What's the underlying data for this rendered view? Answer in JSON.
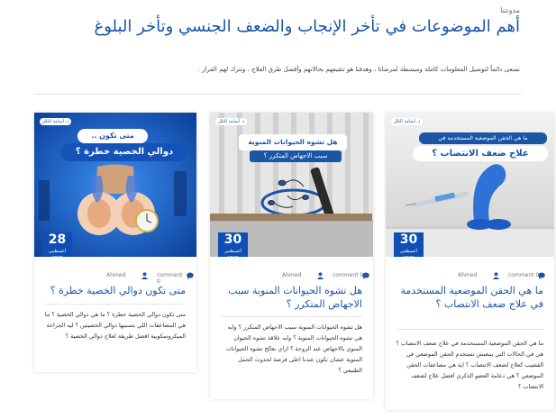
{
  "breadcrumb": "مدونتنا",
  "page_title": "أهم الموضوعات في تأخر الإنجاب والضعف الجنسي وتأخر البلوغ",
  "subtitle": "نسعى دائماً لتوصيل المعلومات كاملة ومبسطة لمرضانا ، وهدفنا هو تثقيفهم بحالاتهم وأفضل طرق العلاج ، وتترك لهم القرار .",
  "colors": {
    "title": "#1a56a6",
    "date_badge": "#0f4fb3"
  },
  "cards": [
    {
      "day": "30",
      "month": "أغسطس 2025",
      "author": "Ahmed",
      "comments": "comment 0",
      "image_logo": "د. أسامة الثلل",
      "image_heading_1": "ما هي الحقن الموضعية المستخدمة في",
      "image_heading_2": "علاج ضعف الانتصاب ؟",
      "title": "ما هي الحقن الموضعية المستخدمة في علاج ضعف الانتصاب ؟",
      "excerpt": "ما هي الحقن الموضعية المستخدمة في علاج ضعف الانتصاب ؟ هي في الحالات التي ينبغيش تستخدم الحقن الموضعي في القضيب كعلاج لضعف الانتصاب ؟ اية هي مضاعفات الحقن الموضعي ؟ هي دعامة العضو الذكري افضل علاج لضعف الانتصاب ؟"
    },
    {
      "day": "30",
      "month": "أغسطس 2025",
      "author": "Ahmed",
      "comments": "comment 0",
      "image_logo": "د. أسامة الثلل",
      "image_heading_1": "هل تشوه الحيوانات المنوية",
      "image_heading_2": "سبب الاجهاض المتكرر ؟",
      "title": "هل تشوه الحيوانات المنوية سبب الاجهاض المتكرر ؟",
      "excerpt": "هل تشوه الحيوانات المنوية سبب الاجهاض المتكرر ؟ وايه هي تشوه الحيوانات المنوية ؟ وايه علاقة تشوه الحيوان المنوي بالاجهاض عند الزوجة ؟ ازاي نعالج تشوه الحيوانات المنوية عشان نكون عندنا اعلى فرصة لحدوث الحمل الطبيعي ؟"
    },
    {
      "day": "28",
      "month": "أغسطس 2025",
      "author": "Ahmed",
      "comments": "comment 0",
      "image_logo": "د. أسامة الثلل",
      "image_heading_1": "متى تكون ..",
      "image_heading_2": "دوالي الخصية خطرة ؟",
      "title": "متى تكون دوالي الخصية خطرة ؟",
      "excerpt": "متى تكون دوالي الخصية خطرة ؟ ما هي دوالي الخصية ؟ ما هي المضاعفات اللي بتسببها دوالي الخصيتين ؟ ليه الجراحة الميكروسكوبية افضل طريقة لعلاج دوالي الخصية ؟"
    }
  ]
}
